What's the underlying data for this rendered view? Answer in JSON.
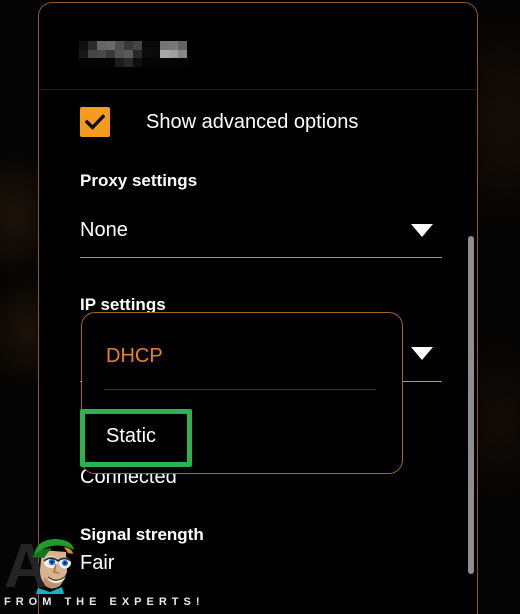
{
  "window": {
    "title_redacted": true,
    "title_placeholder": ""
  },
  "colors": {
    "accent_orange": "#F49B20",
    "selected_option_orange": "#E8821E",
    "card_border": "#8a5a23",
    "popup_border": "#a3671f",
    "highlight_green": "#2FB24C",
    "background": "#040404",
    "text_primary": "#ffffff",
    "underline_gray": "#9a9a9a",
    "scrollbar": "#8d8d8d"
  },
  "advanced": {
    "label": "Show advanced options",
    "checked": true,
    "checkbox_icon": "checkmark-icon"
  },
  "proxy": {
    "label": "Proxy settings",
    "value": "None",
    "chevron_icon": "chevron-down-icon"
  },
  "ip": {
    "label": "IP settings",
    "value": "DHCP",
    "chevron_icon": "chevron-down-icon",
    "dropdown_open": true,
    "options": [
      {
        "label": "DHCP",
        "selected": true
      },
      {
        "label": "Static",
        "selected": false
      }
    ],
    "highlighted_option": "Static"
  },
  "status": {
    "value": "Connected"
  },
  "signal": {
    "label": "Signal strength",
    "value": "Fair"
  },
  "scrollbar": {
    "visible": true
  },
  "watermark": {
    "letter": "A",
    "tagline": "FROM THE EXPERTS!"
  }
}
